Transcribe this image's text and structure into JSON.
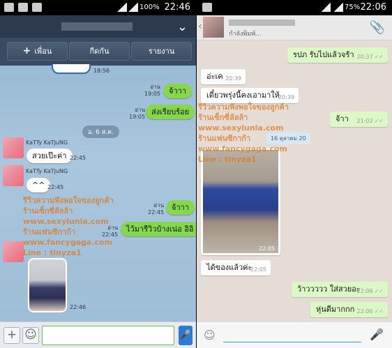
{
  "left": {
    "status": {
      "battery": "100%",
      "time": "22:46"
    },
    "actions": [
      "เพื่อน",
      "กีดกัน",
      "รายงาน"
    ],
    "read_label": "อ่าน",
    "date_divider": "อ. 6 ส.ค.",
    "sender": "KaTTy KaTJuNG",
    "messages": [
      {
        "text": "",
        "time": "18:56"
      },
      {
        "text": "จ้าาา",
        "time": "19:05"
      },
      {
        "text": "ส่งเรียบร้อย",
        "time": "19:05"
      },
      {
        "text": "สวยเป๊ะค่า",
        "time": "22:45"
      },
      {
        "text": "^^",
        "time": "22:45"
      },
      {
        "text": "จ้าาา",
        "time": "22:45"
      },
      {
        "text": "ไว้มารีวิวบ้างเน่อ อิอิ",
        "time": "22:45"
      },
      {
        "text": "",
        "time": "22:46"
      }
    ],
    "input": {
      "plus": "+",
      "sticker": "☺",
      "mic": "🎤"
    }
  },
  "watermark": [
    "รีวิวความพึงพอใจของลูกค้า",
    "ร้านเซ็กซี่ลัลล้า",
    "www.sexylunla.com",
    "ร้านแฟนซีกาก้า",
    "www.fancygaga.com",
    "Line : tinyza1"
  ],
  "right": {
    "status": {
      "battery": "75%",
      "time": "22:06"
    },
    "header": {
      "subtitle": "กำลังพิมพ์..."
    },
    "messages": [
      {
        "dir": "out",
        "text": "รปภ รับไปแล้วจร้า",
        "time": "20:37"
      },
      {
        "dir": "in",
        "text": "อ่ะเค",
        "time": "20:39"
      },
      {
        "dir": "in",
        "text": "เดี๋ยวพรุ่งนี้คงเอามาให้",
        "time": "20:39"
      },
      {
        "dir": "out",
        "text": "จ้าา",
        "time": "21:02"
      },
      {
        "dir": "in",
        "text": "",
        "time": "22:05"
      },
      {
        "dir": "in",
        "text": "ได้ของแล้วค่ะ",
        "time": "22:05"
      },
      {
        "dir": "out",
        "text": "ว้าววววว ใส่สวยอะ",
        "time": "22:06"
      },
      {
        "dir": "out",
        "text": "หุ่นดีมากกก",
        "time": "22:06"
      }
    ],
    "date_label": "16 ตุลาคม 20"
  }
}
